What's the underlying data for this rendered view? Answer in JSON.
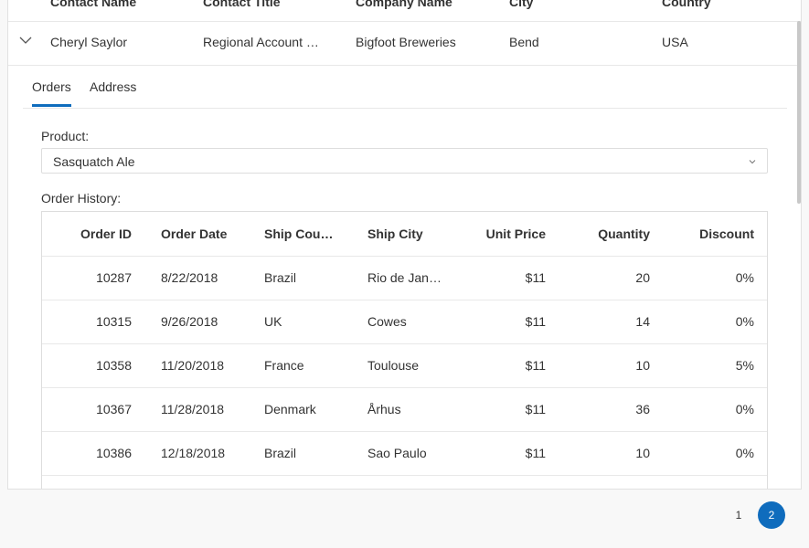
{
  "master": {
    "columns": [
      "Contact Name",
      "Contact Title",
      "Company Name",
      "City",
      "Country"
    ],
    "row": {
      "contact_name": "Cheryl Saylor",
      "contact_title": "Regional Account Representative",
      "company_name": "Bigfoot Breweries",
      "city": "Bend",
      "country": "USA"
    }
  },
  "detail": {
    "tabs": [
      {
        "label": "Orders",
        "selected": true
      },
      {
        "label": "Address",
        "selected": false
      }
    ],
    "product_label": "Product:",
    "product_value": "Sasquatch Ale",
    "history_label": "Order History:",
    "orders": {
      "columns": [
        "Order ID",
        "Order Date",
        "Ship Country",
        "Ship City",
        "Unit Price",
        "Quantity",
        "Discount"
      ],
      "rows": [
        [
          "10287",
          "8/22/2018",
          "Brazil",
          "Rio de Janeiro",
          "$11",
          "20",
          "0%"
        ],
        [
          "10315",
          "9/26/2018",
          "UK",
          "Cowes",
          "$11",
          "14",
          "0%"
        ],
        [
          "10358",
          "11/20/2018",
          "France",
          "Toulouse",
          "$11",
          "10",
          "5%"
        ],
        [
          "10367",
          "11/28/2018",
          "Denmark",
          "Århus",
          "$11",
          "36",
          "0%"
        ],
        [
          "10386",
          "12/18/2018",
          "Brazil",
          "Sao Paulo",
          "$11",
          "10",
          "0%"
        ],
        [
          "",
          "",
          "",
          "",
          "",
          "",
          ""
        ]
      ]
    }
  },
  "pager": {
    "pages": [
      "1",
      "2"
    ],
    "current": "2"
  },
  "colors": {
    "accent": "#0f6cbd",
    "border": "#e1e1e1",
    "background": "#f8f8f8"
  },
  "icons": {
    "expand": "chevron-down-icon",
    "dropdown": "chevron-down-icon"
  }
}
